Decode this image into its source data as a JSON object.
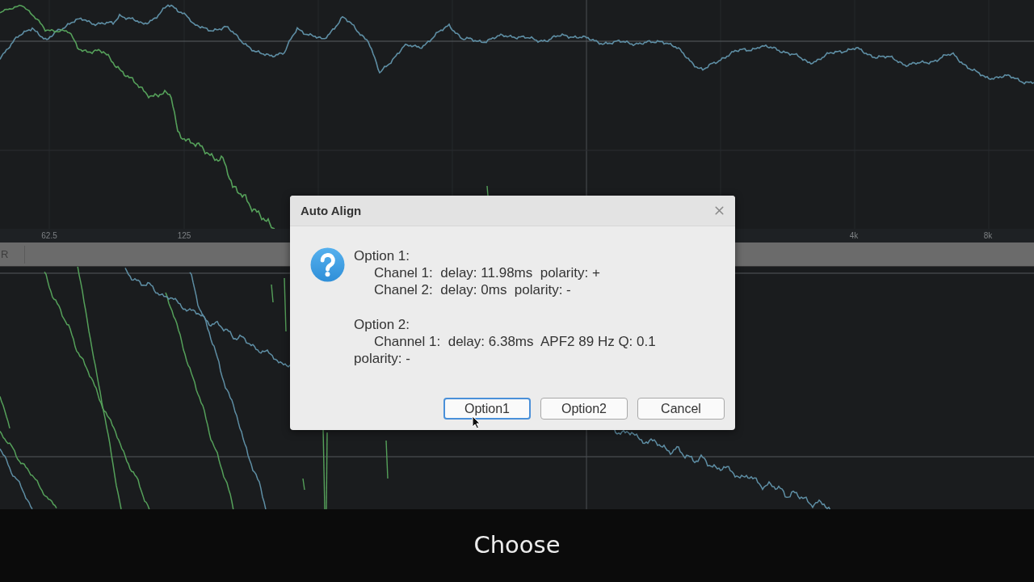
{
  "frequency_axis": {
    "tick_labels": [
      "62.5",
      "125",
      "4k",
      "8k"
    ]
  },
  "track_bar": {
    "label": "R"
  },
  "dialog": {
    "title": "Auto Align",
    "options": [
      {
        "heading": "Option 1:",
        "lines": [
          "Chanel 1:  delay: 11.98ms  polarity: +",
          "Chanel 2:  delay: 0ms  polarity: -"
        ]
      },
      {
        "heading": "Option 2:",
        "lines": [
          "Channel 1:  delay: 6.38ms  APF2 89 Hz Q: 0.1"
        ],
        "continuation": "polarity: -"
      }
    ],
    "buttons": [
      {
        "label": "Option1",
        "focused": true
      },
      {
        "label": "Option2",
        "focused": false
      },
      {
        "label": "Cancel",
        "focused": false
      }
    ]
  },
  "caption": "Choose"
}
